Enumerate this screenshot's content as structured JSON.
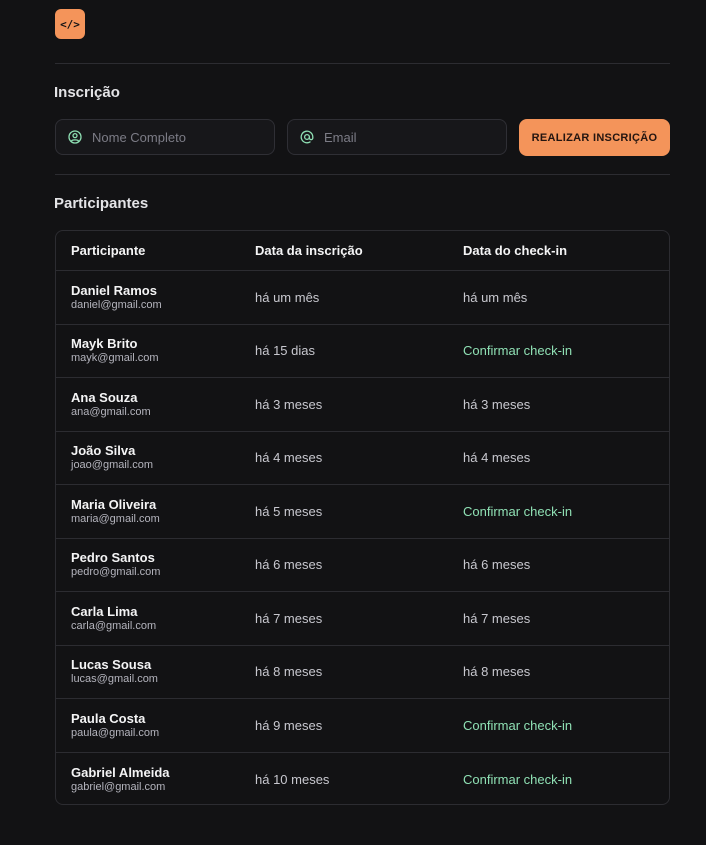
{
  "logo": {
    "glyph": "</>"
  },
  "form": {
    "title": "Inscrição",
    "name_placeholder": "Nome Completo",
    "email_placeholder": "Email",
    "submit_label": "REALIZAR INSCRIÇÃO",
    "icon_accent": "#8fe0b4"
  },
  "participants": {
    "title": "Participantes",
    "headers": [
      "Participante",
      "Data da inscrição",
      "Data do check-in"
    ],
    "rows": [
      {
        "name": "Daniel Ramos",
        "email": "daniel@gmail.com",
        "subscribed": "há um mês",
        "checkin": "há um mês",
        "checked_in": true
      },
      {
        "name": "Mayk Brito",
        "email": "mayk@gmail.com",
        "subscribed": "há 15 dias",
        "checkin": "Confirmar check-in",
        "checked_in": false
      },
      {
        "name": "Ana Souza",
        "email": "ana@gmail.com",
        "subscribed": "há 3 meses",
        "checkin": "há 3 meses",
        "checked_in": true
      },
      {
        "name": "João Silva",
        "email": "joao@gmail.com",
        "subscribed": "há 4 meses",
        "checkin": "há 4 meses",
        "checked_in": true
      },
      {
        "name": "Maria Oliveira",
        "email": "maria@gmail.com",
        "subscribed": "há 5 meses",
        "checkin": "Confirmar check-in",
        "checked_in": false
      },
      {
        "name": "Pedro Santos",
        "email": "pedro@gmail.com",
        "subscribed": "há 6 meses",
        "checkin": "há 6 meses",
        "checked_in": true
      },
      {
        "name": "Carla Lima",
        "email": "carla@gmail.com",
        "subscribed": "há 7 meses",
        "checkin": "há 7 meses",
        "checked_in": true
      },
      {
        "name": "Lucas Sousa",
        "email": "lucas@gmail.com",
        "subscribed": "há 8 meses",
        "checkin": "há 8 meses",
        "checked_in": true
      },
      {
        "name": "Paula Costa",
        "email": "paula@gmail.com",
        "subscribed": "há 9 meses",
        "checkin": "Confirmar check-in",
        "checked_in": false
      },
      {
        "name": "Gabriel Almeida",
        "email": "gabriel@gmail.com",
        "subscribed": "há 10 meses",
        "checkin": "Confirmar check-in",
        "checked_in": false
      }
    ]
  },
  "colors": {
    "background": "#121214",
    "accent": "#f4945a",
    "confirm": "#8fe0b4",
    "border": "#2c2c31"
  }
}
